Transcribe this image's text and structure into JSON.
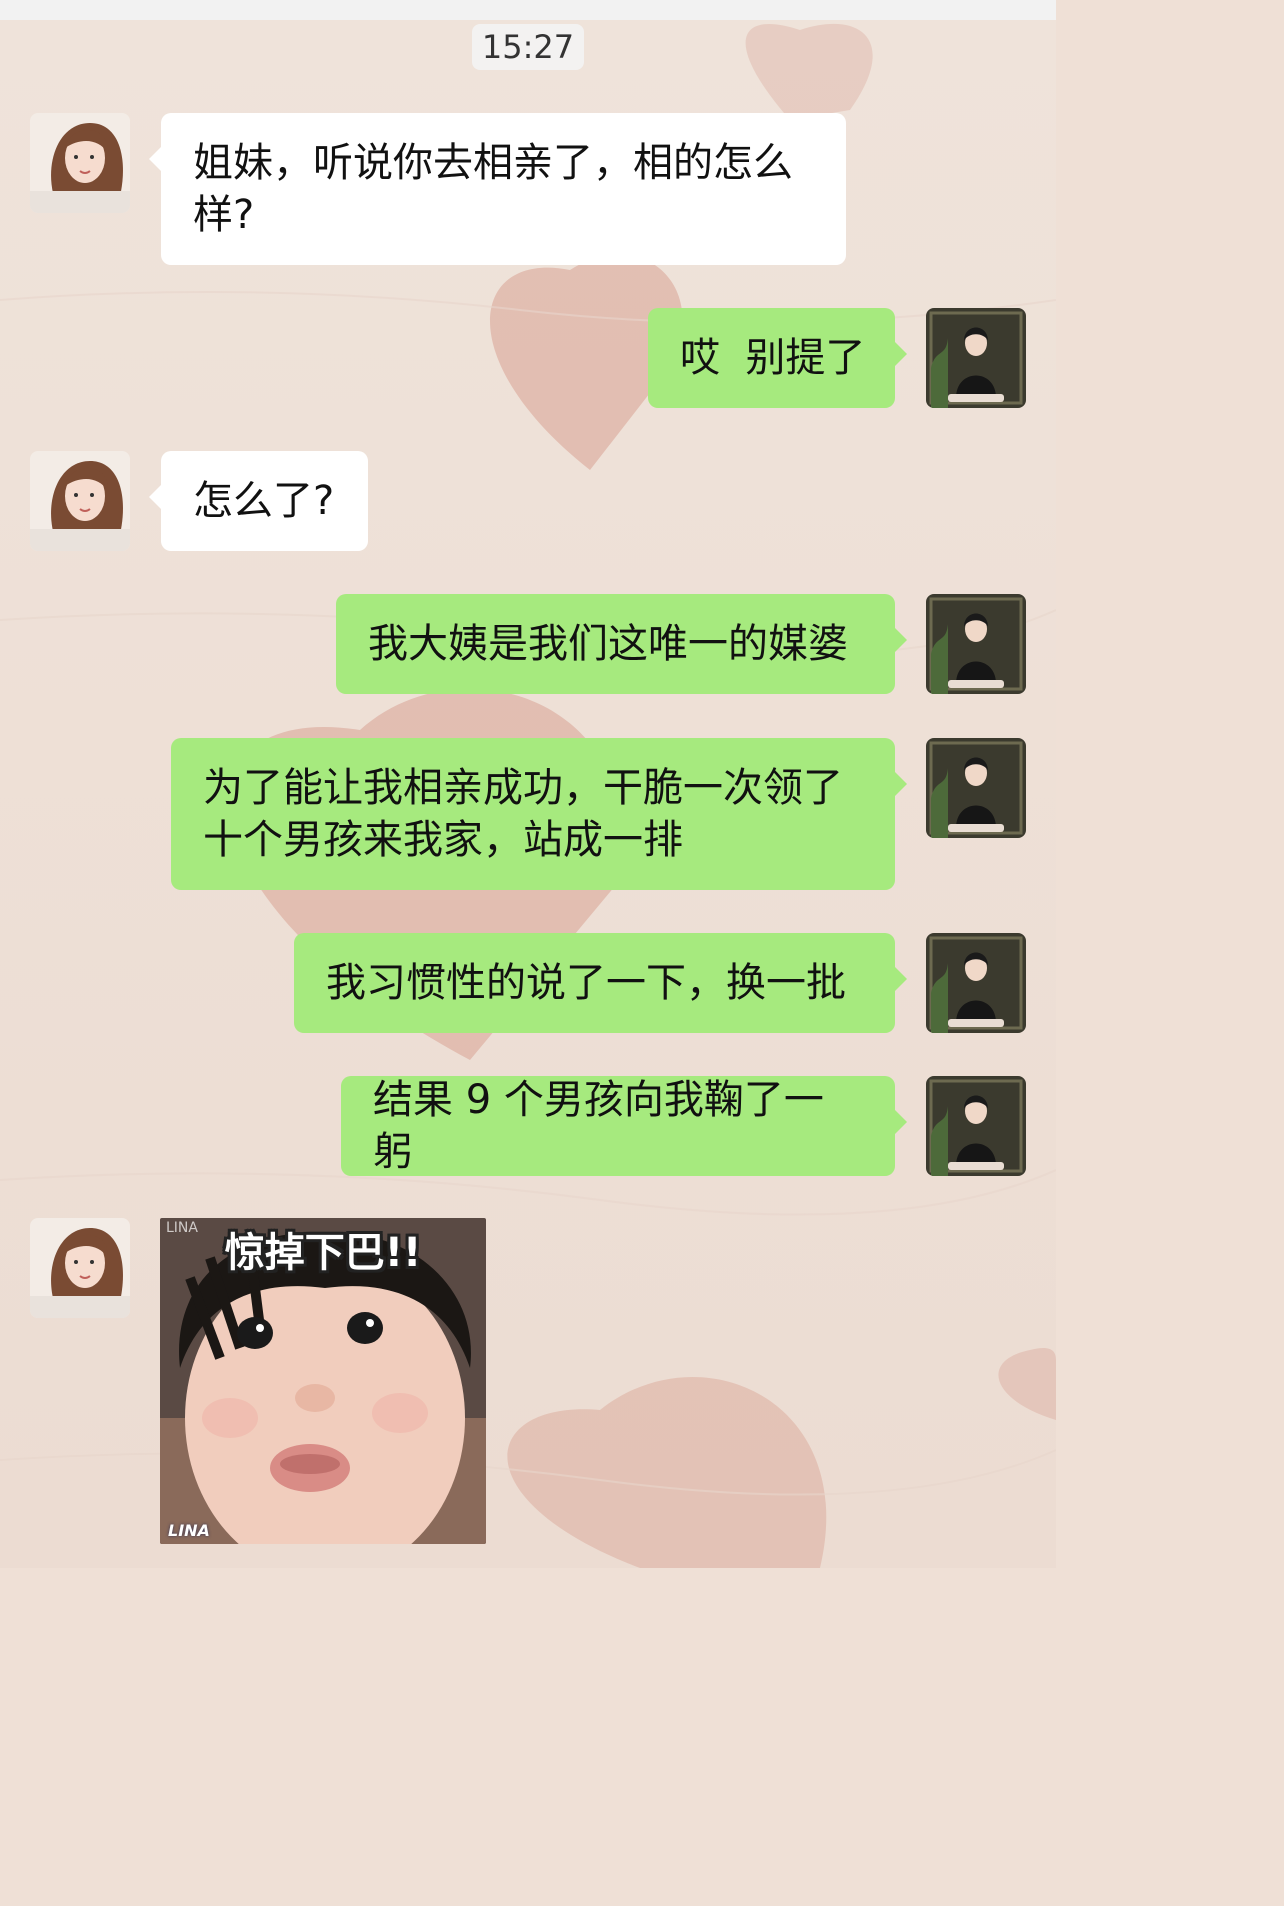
{
  "status": {
    "time": "15:27"
  },
  "messages": [
    {
      "side": "in",
      "text": "姐妹，听说你去相亲了，相的怎么样?"
    },
    {
      "side": "out",
      "text": "哎  别提了"
    },
    {
      "side": "in",
      "text": "怎么了?"
    },
    {
      "side": "out",
      "text": "我大姨是我们这唯一的媒婆"
    },
    {
      "side": "out",
      "text": "为了能让我相亲成功，干脆一次领了十个男孩来我家，站成一排"
    },
    {
      "side": "out",
      "text": "我习惯性的说了一下，换一批"
    },
    {
      "side": "out",
      "text": "结果 9 个男孩向我鞠了一躬"
    }
  ],
  "sticker": {
    "caption": "惊掉下巴!!",
    "watermark": "LINA",
    "watermark_top": "LINA"
  },
  "theme": {
    "incoming_bubble": "#ffffff",
    "outgoing_bubble": "#a6ea7e",
    "background": "#efe0d6",
    "heart_color": "#d9a394"
  }
}
